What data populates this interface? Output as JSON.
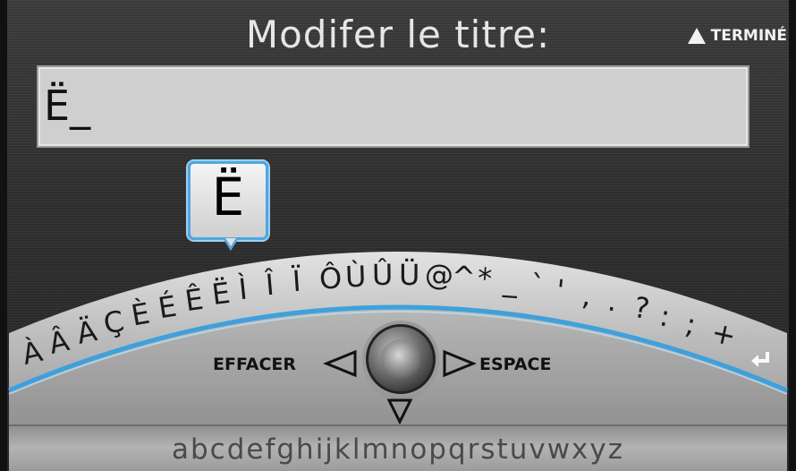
{
  "title": "Modifer le titre:",
  "done_label": "TERMINÉ",
  "input": {
    "value": "Ë_"
  },
  "selected_char": "Ë",
  "arc_keys": [
    "À",
    "Â",
    "Ä",
    "Ç",
    "È",
    "É",
    "Ê",
    "Ë",
    "Ì",
    "Î",
    "Ï",
    "Ô",
    "Ù",
    "Û",
    "Ü",
    "@",
    "^",
    "*",
    "_",
    "`",
    "'",
    ",",
    ".",
    "?",
    ":",
    ";",
    "+"
  ],
  "enter_icon": "enter-return-icon",
  "controls": {
    "delete_label": "EFFACER",
    "space_label": "ESPACE"
  },
  "lowercase_row": "abcdefghijklmnopqrstuvwxyz",
  "colors": {
    "accent": "#52a6e0",
    "arc_line": "#3ea0dc"
  }
}
